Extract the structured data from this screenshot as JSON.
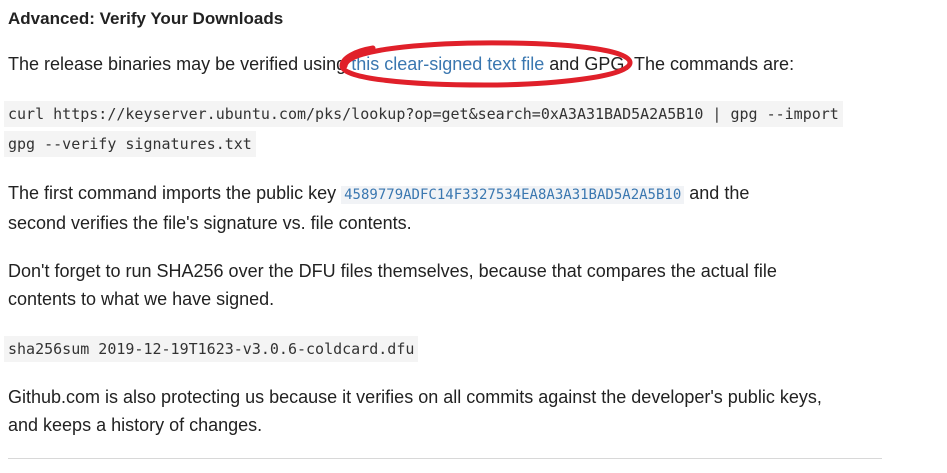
{
  "heading": "Advanced: Verify Your Downloads",
  "para1": {
    "before": "The release binaries may be verified using ",
    "link": "this clear-signed text file",
    "after": " and GPG. The commands are:"
  },
  "commands": {
    "line1": "curl https://keyserver.ubuntu.com/pks/lookup?op=get&search=0xA3A31BAD5A2A5B10 | gpg --import",
    "line2": "gpg --verify signatures.txt"
  },
  "para2": {
    "before": "The first command imports the public key ",
    "key": "4589779ADFC14F3327534EA8A3A31BAD5A2A5B10",
    "after": " and the",
    "line2": "second verifies the file's signature vs. file contents."
  },
  "para3": {
    "line1": "Don't forget to run SHA256 over the DFU files themselves, because that compares the actual file",
    "line2": "contents to what we have signed."
  },
  "sha_command": "sha256sum 2019-12-19T1623-v3.0.6-coldcard.dfu",
  "para4": {
    "line1": "Github.com is also protecting us because it verifies on all commits against the developer's public keys,",
    "line2": "and keeps a history of changes."
  },
  "colors": {
    "link": "#3a77b0",
    "annotation": "#e0202a",
    "code_bg": "#f4f4f4"
  }
}
